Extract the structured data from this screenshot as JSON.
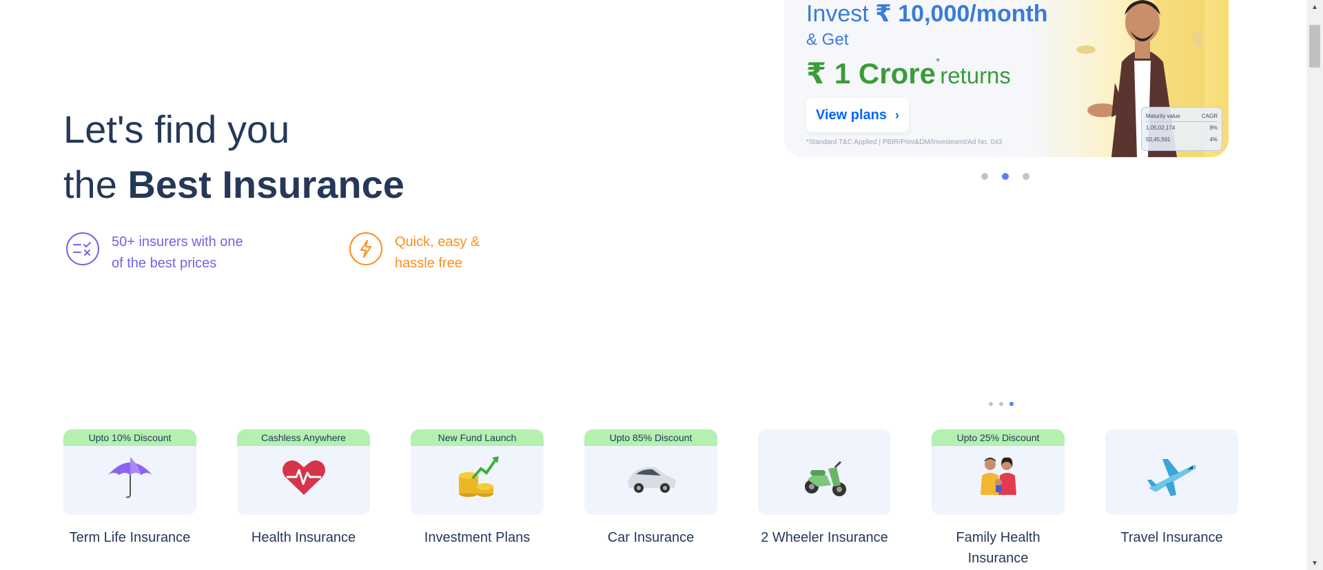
{
  "hero": {
    "title_line1": "Let's find you",
    "title_line2_prefix": "the ",
    "title_line2_bold": "Best Insurance",
    "features": [
      {
        "icon": "compare-icon",
        "line1": "50+ insurers with one",
        "line2": "of the best prices",
        "color": "#7064e5"
      },
      {
        "icon": "lightning-icon",
        "line1": "Quick, easy &",
        "line2": "hassle free",
        "color": "#ff8d1a"
      }
    ]
  },
  "banner": {
    "invest_prefix": "Invest ",
    "invest_amount": "₹ 10,000/month",
    "get": "& Get",
    "crore_amount": "₹ 1 Crore",
    "crore_star": "*",
    "returns": "returns",
    "cta": "View plans",
    "disclaimer": "*Standard T&C Applied | PBIR/Print&DM/Investment/Ad No. 043",
    "table": {
      "headers": [
        "Maturity value",
        "CAGR"
      ],
      "rows": [
        [
          "1,05,02,174",
          "8%"
        ],
        [
          "50,45,591",
          "4%"
        ]
      ]
    },
    "carousel": {
      "count": 3,
      "active": 1
    }
  },
  "products_carousel": {
    "count": 3,
    "active": 2
  },
  "products": [
    {
      "tag": "Upto 10% Discount",
      "name": "Term Life Insurance",
      "icon": "umbrella-icon"
    },
    {
      "tag": "Cashless Anywhere",
      "name": "Health Insurance",
      "icon": "heart-pulse-icon"
    },
    {
      "tag": "New Fund Launch",
      "name": "Investment Plans",
      "icon": "coins-growth-icon"
    },
    {
      "tag": "Upto 85% Discount",
      "name": "Car Insurance",
      "icon": "car-icon"
    },
    {
      "tag": "",
      "name": "2 Wheeler Insurance",
      "icon": "scooter-icon"
    },
    {
      "tag": "Upto 25% Discount",
      "name_line1": "Family Health",
      "name_line2": "Insurance",
      "icon": "family-icon"
    },
    {
      "tag": "",
      "name": "Travel Insurance",
      "icon": "airplane-icon"
    }
  ]
}
